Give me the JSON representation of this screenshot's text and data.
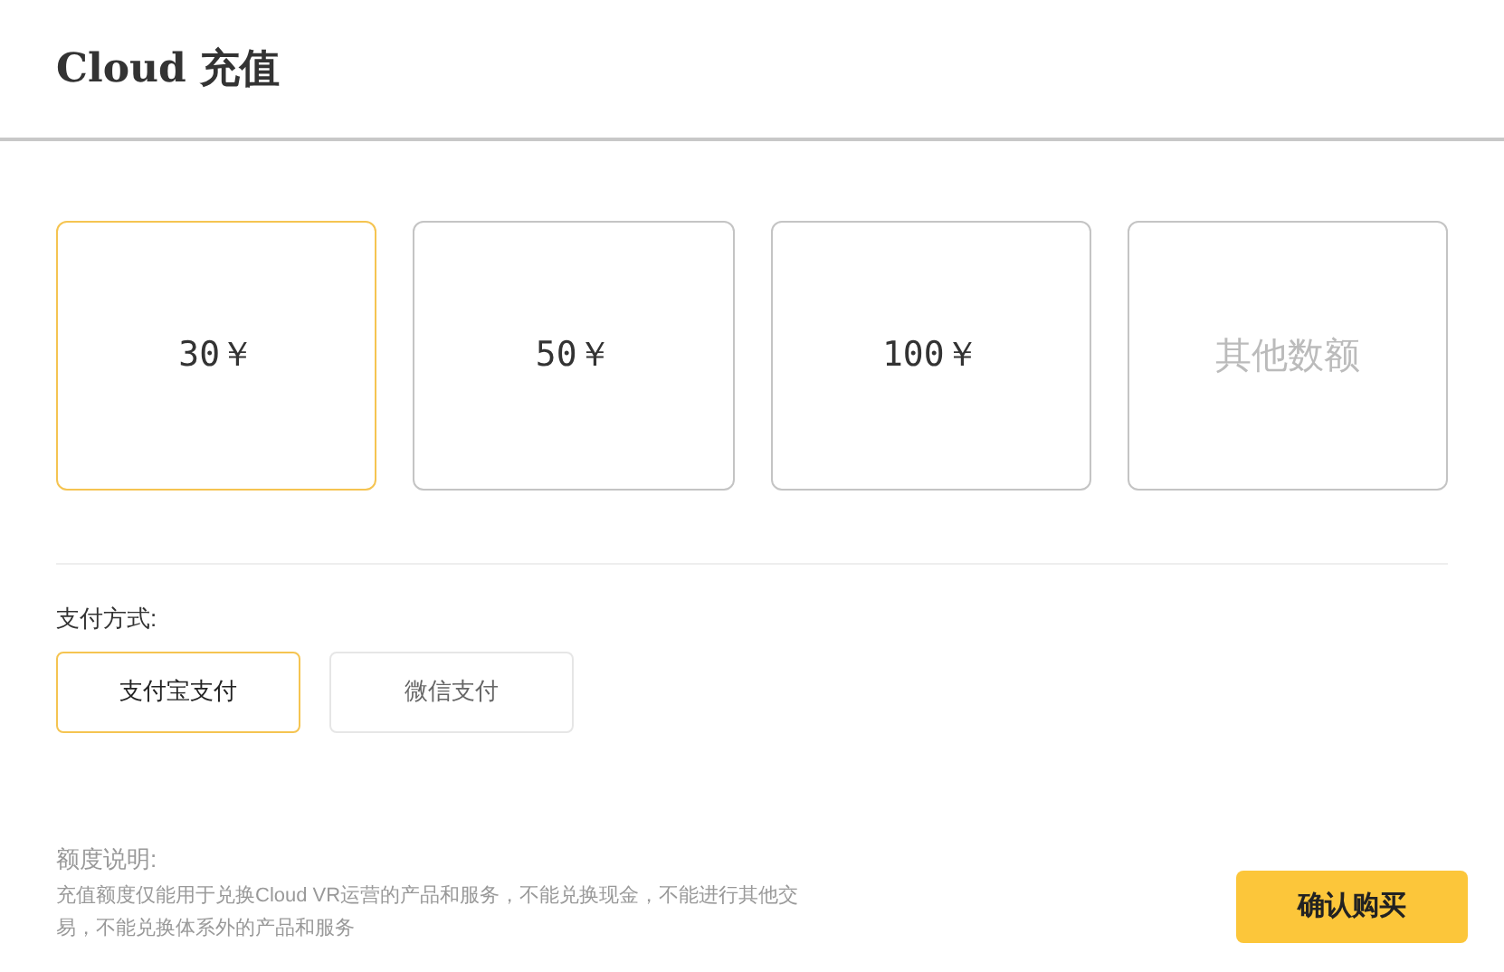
{
  "header": {
    "title": "Cloud 充值"
  },
  "amounts": [
    {
      "label": "30￥",
      "kind": "amount",
      "selected": true
    },
    {
      "label": "50￥",
      "kind": "amount",
      "selected": false
    },
    {
      "label": "100￥",
      "kind": "amount",
      "selected": false
    },
    {
      "label": "其他数额",
      "kind": "custom",
      "selected": false
    }
  ],
  "payment": {
    "label": "支付方式:",
    "methods": [
      {
        "label": "支付宝支付",
        "selected": true
      },
      {
        "label": "微信支付",
        "selected": false
      }
    ]
  },
  "note": {
    "title": "额度说明:",
    "text": "充值额度仅能用于兑换Cloud VR运营的产品和服务，不能兑换现金，不能进行其他交易，不能兑换体系外的产品和服务"
  },
  "confirm_button": "确认购买"
}
